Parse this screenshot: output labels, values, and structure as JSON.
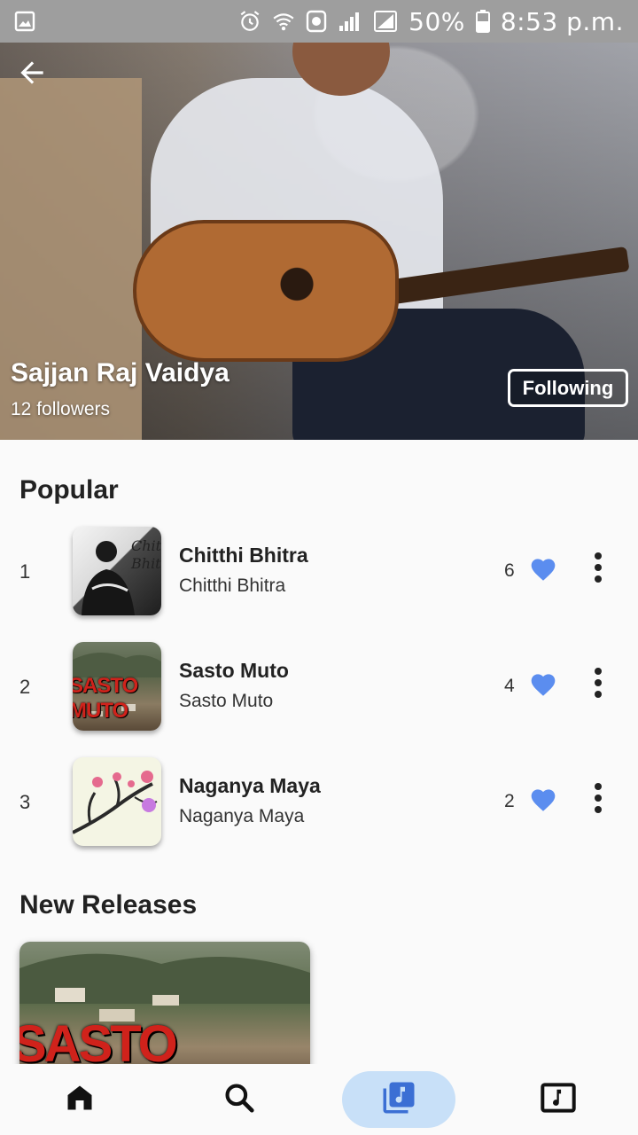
{
  "status_bar": {
    "battery": "50%",
    "time": "8:53 p.m."
  },
  "artist": {
    "name": "Sajjan Raj Vaidya",
    "followers": "12 followers",
    "follow_button_label": "Following"
  },
  "popular": {
    "title": "Popular",
    "songs": [
      {
        "rank": "1",
        "title": "Chitthi Bhitra",
        "subtitle": "Chitthi Bhitra",
        "likes": "6",
        "art_text": "Chitthi\nBhitra"
      },
      {
        "rank": "2",
        "title": "Sasto Muto",
        "subtitle": "Sasto Muto",
        "likes": "4",
        "art_text": "SASTO MUTO"
      },
      {
        "rank": "3",
        "title": "Naganya Maya",
        "subtitle": "Naganya Maya",
        "likes": "2"
      }
    ]
  },
  "new_releases": {
    "title": "New Releases",
    "cards": [
      {
        "art_text": "SASTO MUTO"
      }
    ]
  },
  "colors": {
    "accent_heart": "#5b8def",
    "nav_active_bg": "#c8e0f8",
    "nav_active_icon": "#3b6fd4"
  },
  "icons": {
    "back": "arrow-left-icon",
    "like": "heart-icon",
    "more": "more-vert-icon",
    "nav": [
      "home-icon",
      "search-icon",
      "library-music-icon",
      "music-note-box-icon"
    ]
  }
}
